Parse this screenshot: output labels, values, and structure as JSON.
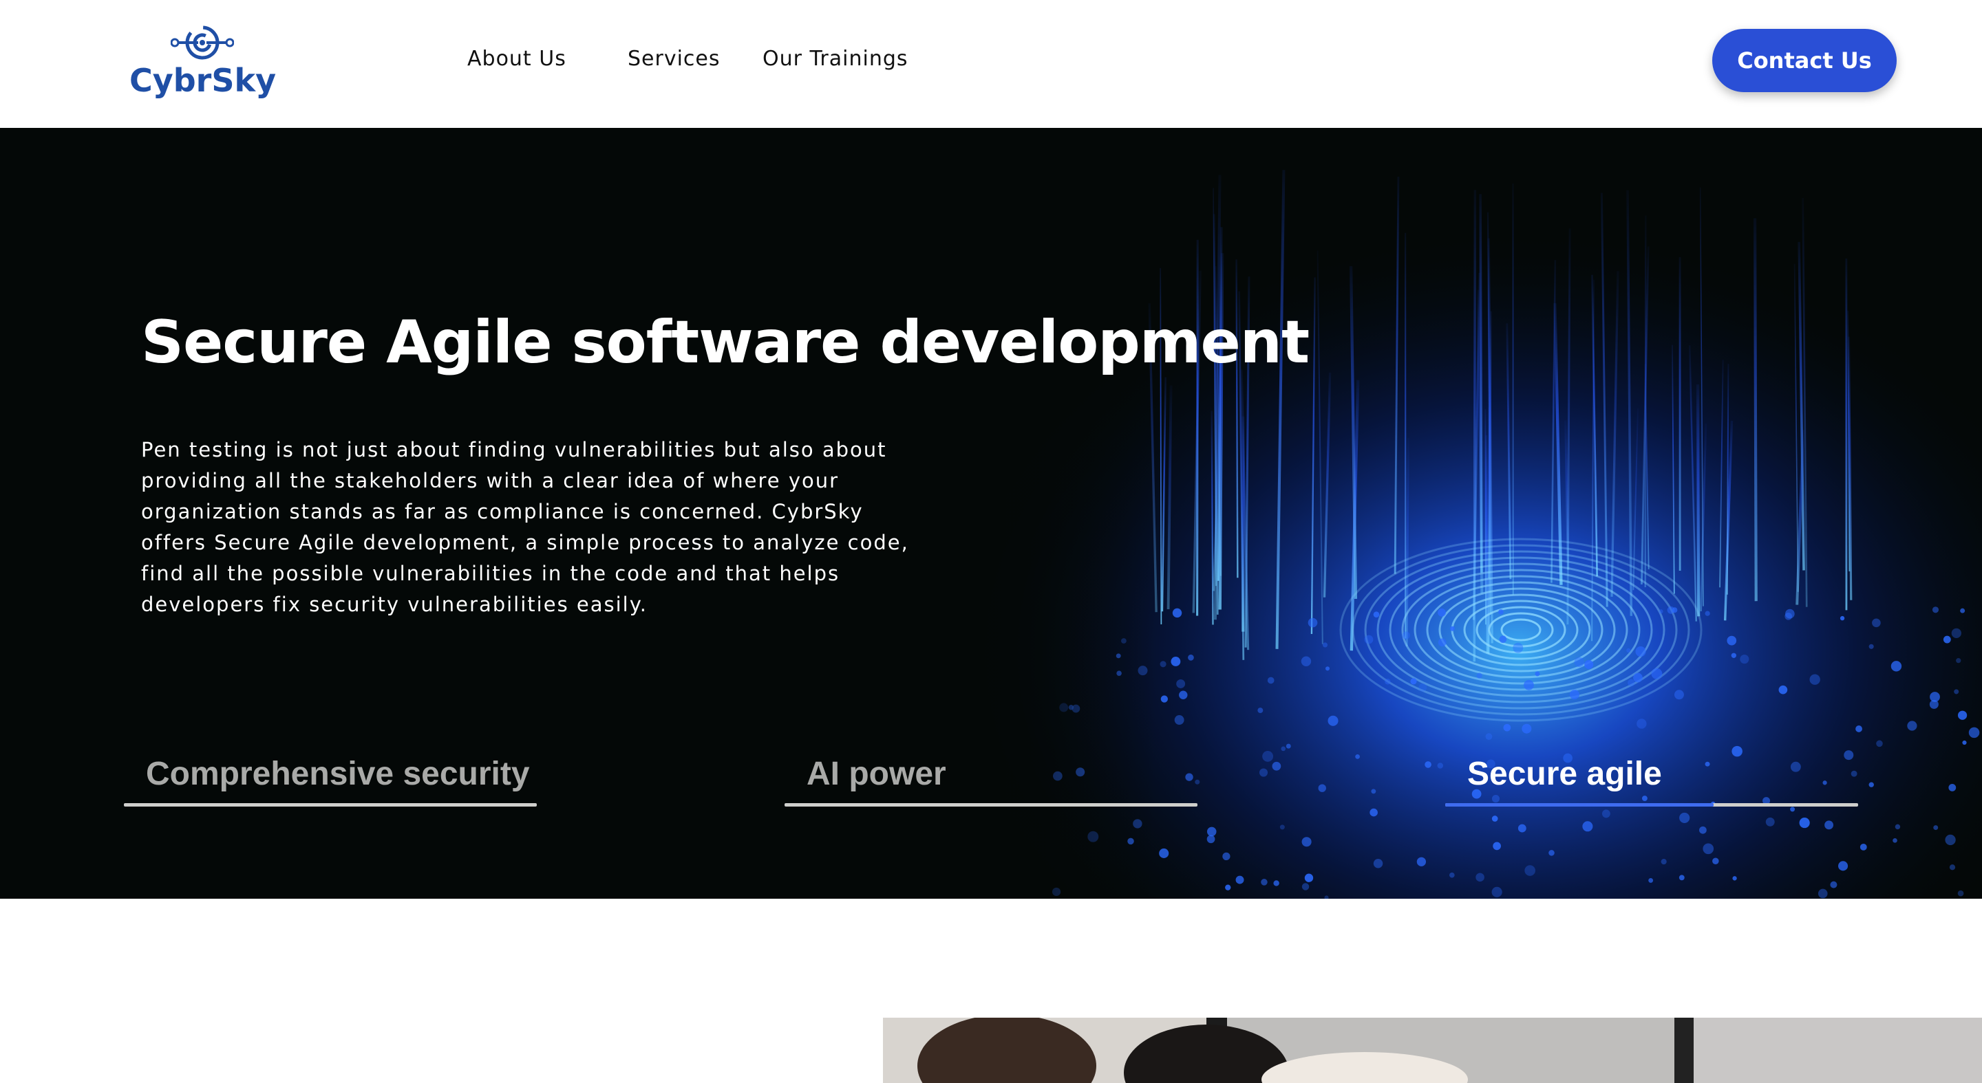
{
  "header": {
    "logo_text": "CybrSky",
    "nav": [
      {
        "label": "About Us"
      },
      {
        "label": "Services"
      },
      {
        "label": "Our Trainings"
      }
    ],
    "contact_label": "Contact Us"
  },
  "hero": {
    "title": "Secure Agile software development",
    "description": "Pen testing is not just about finding vulnerabilities but also about providing all the stakeholders with a clear idea of where your organization stands as far as compliance is concerned. CybrSky offers Secure Agile development, a simple process to analyze code, find all the possible vulnerabilities in the code and that helps developers fix security vulnerabilities easily.",
    "tabs": [
      {
        "label": "Comprehensive security",
        "active": false,
        "progress": 0
      },
      {
        "label": "AI power",
        "active": false,
        "progress": 0
      },
      {
        "label": "Secure agile",
        "active": true,
        "progress": 0.65
      }
    ]
  },
  "colors": {
    "brand": "#1f4fa6",
    "button": "#2a4fd6",
    "hero_bg": "#040807",
    "tab_progress": "#3f6cf0"
  },
  "icons": {
    "logo": "target-circuit-icon"
  }
}
